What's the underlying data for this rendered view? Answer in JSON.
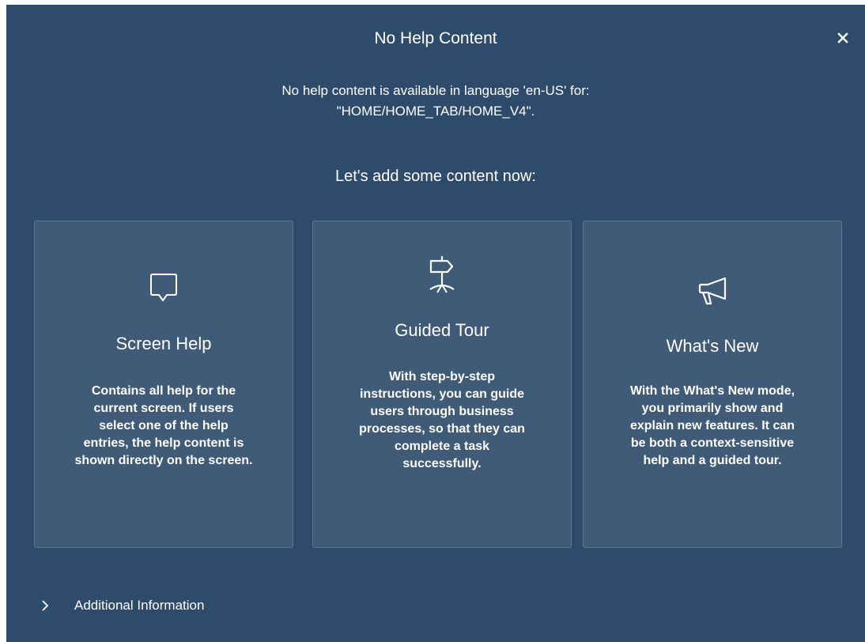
{
  "dialog": {
    "title": "No Help Content",
    "close_icon": "close-icon",
    "message_line1": "No help content is available in language 'en-US' for:",
    "message_line2": "\"HOME/HOME_TAB/HOME_V4\".",
    "prompt": "Let's add some content now:"
  },
  "cards": [
    {
      "icon": "speech-bubble-icon",
      "title": "Screen Help",
      "description": "Contains all help for the\ncurrent screen. If users\nselect one of the help\nentries, the help content is\nshown directly on the screen."
    },
    {
      "icon": "signpost-icon",
      "title": "Guided Tour",
      "description": "With step-by-step\ninstructions, you can guide\nusers through business\nprocesses, so that they can\ncomplete a task\nsuccessfully."
    },
    {
      "icon": "megaphone-icon",
      "title": "What's New",
      "description": "With the What's New mode,\nyou primarily show and\nexplain new features. It can\nbe both a context-sensitive\nhelp and a guided tour."
    }
  ],
  "additional": {
    "icon": "chevron-right-icon",
    "label": "Additional Information"
  },
  "colors": {
    "background": "#2e4b6b",
    "card_background": "#3f5b78",
    "card_border": "#5d7690",
    "text": "#ffffff"
  }
}
